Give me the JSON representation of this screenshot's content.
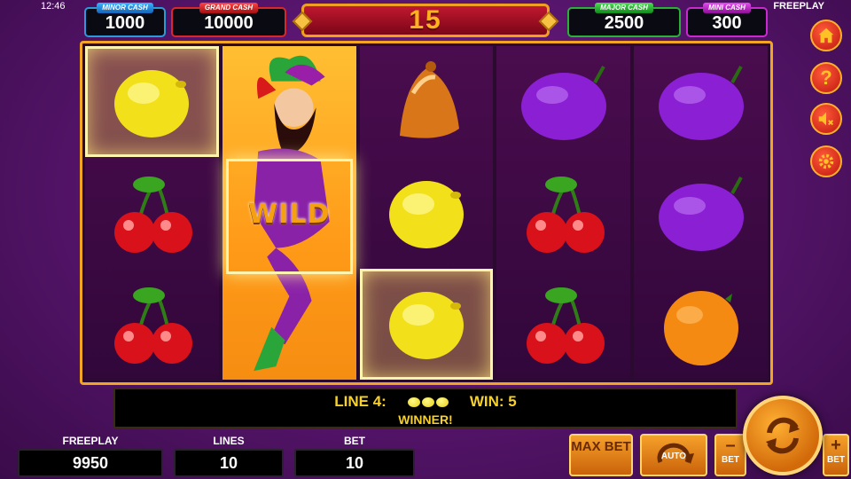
{
  "status": {
    "time": "12:46",
    "mode": "FREEPLAY"
  },
  "jackpots": {
    "minor": {
      "label": "MINOR CASH",
      "value": "1000"
    },
    "grand": {
      "label": "GRAND CASH",
      "value": "10000"
    },
    "major": {
      "label": "MAJOR CASH",
      "value": "2500"
    },
    "mini": {
      "label": "MINI CASH",
      "value": "300"
    }
  },
  "banner": {
    "value": "15"
  },
  "reels": [
    [
      "lemon",
      "cherry",
      "cherry"
    ],
    [
      "jester-wild",
      "jester-wild",
      "jester-wild"
    ],
    [
      "bell",
      "lemon",
      "lemon"
    ],
    [
      "plum",
      "cherry",
      "cherry"
    ],
    [
      "plum",
      "plum",
      "orange"
    ]
  ],
  "wild_label": "WILD",
  "win_line": {
    "line_label": "LINE 4:",
    "win_label": "WIN: 5",
    "status": "WINNER!"
  },
  "bottom": {
    "freeplay_label": "FREEPLAY",
    "freeplay_value": "9950",
    "lines_label": "LINES",
    "lines_value": "10",
    "bet_label": "BET",
    "bet_value": "10"
  },
  "controls": {
    "max_bet": "MAX BET",
    "auto": "AUTO",
    "bet_minus": "–",
    "bet_minus_label": "BET",
    "bet_plus": "+",
    "bet_plus_label": "BET"
  },
  "side_buttons": [
    "home-icon",
    "help-icon",
    "sound-off-icon",
    "settings-icon"
  ],
  "colors": {
    "frame": "#f2a422",
    "banner": "#c01830",
    "win_text": "#f7d12a"
  }
}
